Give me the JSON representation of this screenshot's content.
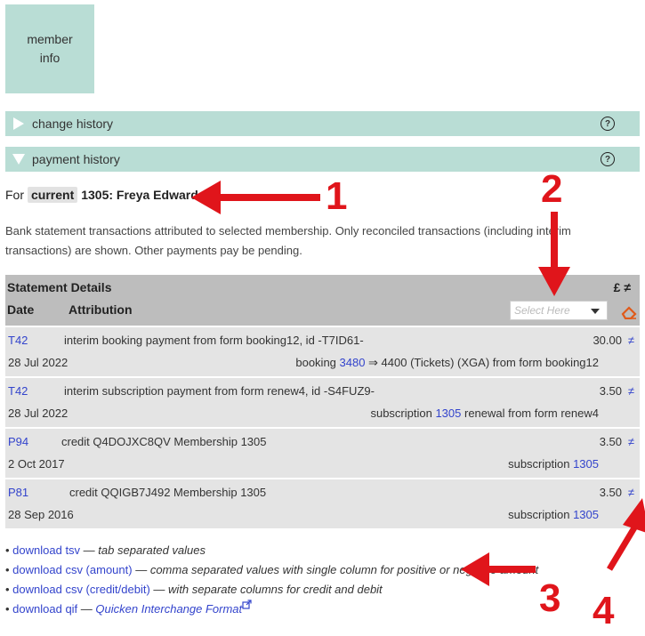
{
  "member_box": {
    "label": "member\ninfo"
  },
  "accordions": [
    {
      "label": "change history",
      "expanded": false
    },
    {
      "label": "payment history",
      "expanded": true
    }
  ],
  "for_line": {
    "prefix": "For",
    "status": "current",
    "member": "1305: Freya Edwards"
  },
  "description": "Bank statement transactions attributed to selected membership. Only reconciled transactions (including interim transactions) are shown. Other payments pay be pending.",
  "table": {
    "header_title": "Statement Details",
    "header_currency": "£ ≠",
    "col_date": "Date",
    "col_attribution": "Attribution",
    "select_placeholder": "Select Here",
    "rows": [
      {
        "code": "T42",
        "desc": "interim booking payment from form booking12, id -T7ID61-",
        "amount": "30.00",
        "ne": "≠",
        "date": "28 Jul 2022",
        "attr_pre": "booking ",
        "attr_link": "3480",
        "attr_post": " ⇒ 4400 (Tickets) (XGA) from form booking12"
      },
      {
        "code": "T42",
        "desc": "interim subscription payment from form renew4, id -S4FUZ9-",
        "amount": "3.50",
        "ne": "≠",
        "date": "28 Jul 2022",
        "attr_pre": "subscription ",
        "attr_link": "1305",
        "attr_post": " renewal from form renew4"
      },
      {
        "code": "P94",
        "desc": "credit Q4DOJXC8QV Membership 1305",
        "amount": "3.50",
        "ne": "≠",
        "date": "2 Oct 2017",
        "attr_pre": "subscription ",
        "attr_link": "1305",
        "attr_post": ""
      },
      {
        "code": "P81",
        "desc": "credit QQIGB7J492 Membership 1305",
        "amount": "3.50",
        "ne": "≠",
        "date": "28 Sep 2016",
        "attr_pre": "subscription ",
        "attr_link": "1305",
        "attr_post": ""
      }
    ]
  },
  "downloads": [
    {
      "link": "download tsv",
      "note": "tab separated values"
    },
    {
      "link": "download csv (amount)",
      "note": "comma separated values with single column for positive or negative amount"
    },
    {
      "link": "download csv (credit/debit)",
      "note": "with separate columns for credit and debit"
    },
    {
      "link": "download qif",
      "note": "Quicken Interchange Format"
    }
  ],
  "callouts": [
    "1",
    "2",
    "3",
    "4"
  ],
  "colors": {
    "accent_teal": "#b9ddd5",
    "link": "#3344cc",
    "callout_red": "#e0151b"
  },
  "icons": {
    "help": "question-circle-icon",
    "eraser": "eraser-icon",
    "external": "external-link-icon"
  }
}
